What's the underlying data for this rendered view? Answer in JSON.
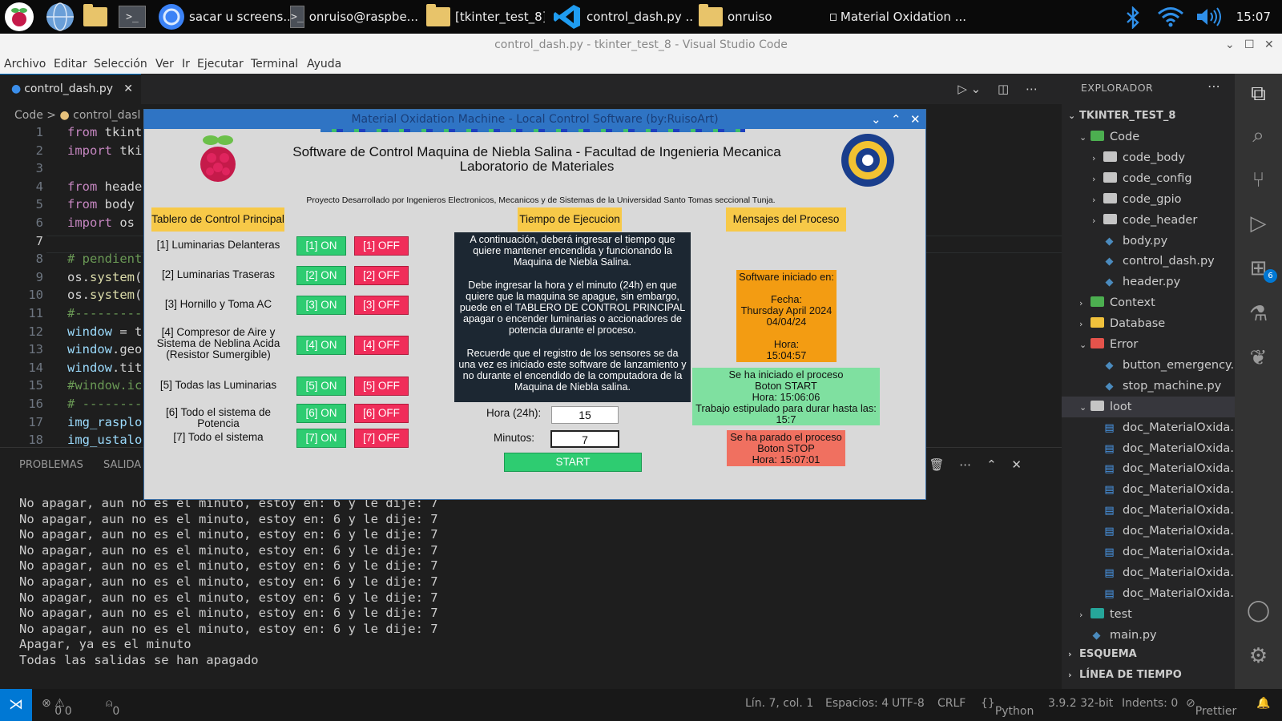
{
  "taskbar": {
    "items": [
      {
        "label": "sacar u screens..."
      },
      {
        "label": "onruiso@raspbe..."
      },
      {
        "label": "[tkinter_test_8]"
      },
      {
        "label": "control_dash.py ..."
      },
      {
        "label": "onruiso"
      },
      {
        "label": "Material Oxidation ..."
      }
    ],
    "terminal_glyph": ">_",
    "clock": "15:07"
  },
  "window": {
    "title": "control_dash.py - tkinter_test_8 - Visual Studio Code"
  },
  "menu": [
    "Archivo",
    "Editar",
    "Selección",
    "Ver",
    "Ir",
    "Ejecutar",
    "Terminal",
    "Ayuda"
  ],
  "editor": {
    "tab": "control_dash.py",
    "breadcrumb_root": "Code",
    "breadcrumb_sep": ">",
    "breadcrumb_file": "control_dasl",
    "lines": [
      {
        "n": "1",
        "parts": [
          {
            "t": "from ",
            "c": "kw"
          },
          {
            "t": "tkint",
            "c": "tx"
          }
        ]
      },
      {
        "n": "2",
        "parts": [
          {
            "t": "import ",
            "c": "kw"
          },
          {
            "t": "tki",
            "c": "tx"
          }
        ]
      },
      {
        "n": "3",
        "parts": []
      },
      {
        "n": "4",
        "parts": [
          {
            "t": "from ",
            "c": "kw"
          },
          {
            "t": "heade",
            "c": "tx"
          }
        ]
      },
      {
        "n": "5",
        "parts": [
          {
            "t": "from ",
            "c": "kw"
          },
          {
            "t": "body ",
            "c": "tx"
          }
        ]
      },
      {
        "n": "6",
        "parts": [
          {
            "t": "import ",
            "c": "kw"
          },
          {
            "t": "os ",
            "c": "tx"
          }
        ]
      },
      {
        "n": "7",
        "parts": []
      },
      {
        "n": "8",
        "parts": [
          {
            "t": "# pendient",
            "c": "cm"
          }
        ]
      },
      {
        "n": "9",
        "parts": [
          {
            "t": "os.",
            "c": "tx"
          },
          {
            "t": "system",
            "c": "fn"
          },
          {
            "t": "(",
            "c": "tx"
          }
        ]
      },
      {
        "n": "10",
        "parts": [
          {
            "t": "os.",
            "c": "tx"
          },
          {
            "t": "system",
            "c": "fn"
          },
          {
            "t": "(",
            "c": "tx"
          }
        ]
      },
      {
        "n": "11",
        "parts": [
          {
            "t": "#----------",
            "c": "cm"
          }
        ]
      },
      {
        "n": "12",
        "parts": [
          {
            "t": "window",
            "c": "vr"
          },
          {
            "t": " = t",
            "c": "tx"
          }
        ]
      },
      {
        "n": "13",
        "parts": [
          {
            "t": "window",
            "c": "vr"
          },
          {
            "t": ".geo",
            "c": "tx"
          }
        ]
      },
      {
        "n": "14",
        "parts": [
          {
            "t": "window",
            "c": "vr"
          },
          {
            "t": ".tit",
            "c": "tx"
          }
        ]
      },
      {
        "n": "15",
        "parts": [
          {
            "t": "#window.ic",
            "c": "cm"
          }
        ]
      },
      {
        "n": "16",
        "parts": [
          {
            "t": "# --------",
            "c": "cm"
          }
        ]
      },
      {
        "n": "17",
        "parts": [
          {
            "t": "img_rasplo",
            "c": "vr"
          }
        ]
      },
      {
        "n": "18",
        "parts": [
          {
            "t": "img_ustalo",
            "c": "vr"
          }
        ]
      }
    ]
  },
  "panel": {
    "tabs": [
      "PROBLEMAS",
      "SALIDA"
    ],
    "output": [
      "No apagar, aun no es el minuto, estoy en: 6 y le dije: 7",
      "No apagar, aun no es el minuto, estoy en: 6 y le dije: 7",
      "No apagar, aun no es el minuto, estoy en: 6 y le dije: 7",
      "No apagar, aun no es el minuto, estoy en: 6 y le dije: 7",
      "No apagar, aun no es el minuto, estoy en: 6 y le dije: 7",
      "No apagar, aun no es el minuto, estoy en: 6 y le dije: 7",
      "No apagar, aun no es el minuto, estoy en: 6 y le dije: 7",
      "No apagar, aun no es el minuto, estoy en: 6 y le dije: 7",
      "No apagar, aun no es el minuto, estoy en: 6 y le dije: 7",
      "Apagar, ya es el minuto",
      "Todas las salidas se han apagado"
    ]
  },
  "explorer": {
    "header": "EXPLORADOR",
    "project": "TKINTER_TEST_8",
    "tree": [
      {
        "label": "Code",
        "kind": "folder",
        "open": true,
        "depth": 1,
        "color": "#4caf50"
      },
      {
        "label": "code_body",
        "kind": "folder",
        "open": false,
        "depth": 2,
        "color": "#c5c5c5"
      },
      {
        "label": "code_config",
        "kind": "folder",
        "open": false,
        "depth": 2,
        "color": "#c5c5c5"
      },
      {
        "label": "code_gpio",
        "kind": "folder",
        "open": false,
        "depth": 2,
        "color": "#c5c5c5"
      },
      {
        "label": "code_header",
        "kind": "folder",
        "open": false,
        "depth": 2,
        "color": "#c5c5c5"
      },
      {
        "label": "body.py",
        "kind": "py",
        "depth": 2
      },
      {
        "label": "control_dash.py",
        "kind": "py",
        "depth": 2
      },
      {
        "label": "header.py",
        "kind": "py",
        "depth": 2
      },
      {
        "label": "Context",
        "kind": "folder",
        "open": false,
        "depth": 1,
        "color": "#4caf50"
      },
      {
        "label": "Database",
        "kind": "folder",
        "open": false,
        "depth": 1,
        "color": "#f0c13c"
      },
      {
        "label": "Error",
        "kind": "folder",
        "open": true,
        "depth": 1,
        "color": "#e5534b"
      },
      {
        "label": "button_emergency...",
        "kind": "py",
        "depth": 2
      },
      {
        "label": "stop_machine.py",
        "kind": "py",
        "depth": 2
      },
      {
        "label": "loot",
        "kind": "folder",
        "open": true,
        "depth": 1,
        "color": "#c5c5c5",
        "selected": true
      },
      {
        "label": "doc_MaterialOxida...",
        "kind": "doc",
        "depth": 2
      },
      {
        "label": "doc_MaterialOxida...",
        "kind": "doc",
        "depth": 2
      },
      {
        "label": "doc_MaterialOxida...",
        "kind": "doc",
        "depth": 2
      },
      {
        "label": "doc_MaterialOxida...",
        "kind": "doc",
        "depth": 2
      },
      {
        "label": "doc_MaterialOxida...",
        "kind": "doc",
        "depth": 2
      },
      {
        "label": "doc_MaterialOxida...",
        "kind": "doc",
        "depth": 2
      },
      {
        "label": "doc_MaterialOxida...",
        "kind": "doc",
        "depth": 2
      },
      {
        "label": "doc_MaterialOxida...",
        "kind": "doc",
        "depth": 2
      },
      {
        "label": "doc_MaterialOxida...",
        "kind": "doc",
        "depth": 2
      },
      {
        "label": "test",
        "kind": "folder",
        "open": false,
        "depth": 1,
        "color": "#26a69a"
      },
      {
        "label": "main.py",
        "kind": "py",
        "depth": 1
      }
    ],
    "outline": "ESQUEMA",
    "timeline": "LÍNEA DE TIEMPO"
  },
  "activity": {
    "extensions_badge": "6"
  },
  "statusbar": {
    "errors": "0",
    "warnings": "0",
    "ports": "0",
    "position": "Lín. 7, col. 1",
    "spaces": "Espacios: 4",
    "encoding": "UTF-8",
    "eol": "CRLF",
    "language": "Python",
    "interpreter": "3.9.2 32-bit",
    "indents": "Indents: 0",
    "formatter": "Prettier"
  },
  "app": {
    "title": "Material Oxidation Machine - Local Control Software (by:RuisoArt)",
    "header_line1": "Software de Control Maquina de Niebla Salina - Facultad de Ingenieria Mecanica",
    "header_line2": "Laboratorio de Materiales",
    "subtitle": "Proyecto Desarrollado por Ingenieros Electronicos, Mecanicos y de Sistemas de la Universidad Santo Tomas seccional Tunja.",
    "panel_labels": {
      "control": "Tablero de Control Principal",
      "time": "Tiempo de Ejecucion",
      "messages": "Mensajes del Proceso"
    },
    "controls": [
      {
        "label": "[1] Luminarias Delanteras",
        "on": "[1] ON",
        "off": "[1] OFF"
      },
      {
        "label": "[2] Luminarias Traseras",
        "on": "[2] ON",
        "off": "[2] OFF"
      },
      {
        "label": "[3] Hornillo y Toma AC",
        "on": "[3] ON",
        "off": "[3] OFF"
      },
      {
        "label": "[4] Compresor de Aire y Sistema de Neblina Acida (Resistor Sumergible)",
        "on": "[4] ON",
        "off": "[4] OFF"
      },
      {
        "label": "[5] Todas las Luminarias",
        "on": "[5] ON",
        "off": "[5] OFF"
      },
      {
        "label": "[6] Todo el sistema de Potencia",
        "on": "[6] ON",
        "off": "[6] OFF"
      },
      {
        "label": "[7] Todo el sistema",
        "on": "[7] ON",
        "off": "[7] OFF"
      }
    ],
    "instructions": [
      "A continuación, deberá ingresar el tiempo que quiere mantener encendida y funcionando la Maquina de Niebla Salina.",
      "Debe ingresar la hora y el minuto (24h) en que quiere que la maquina se apague, sin embargo, puede en el TABLERO DE CONTROL PRINCIPAL apagar o encender luminarias o accionadores de potencia durante el proceso.",
      "Recuerde que el registro de los sensores se da una vez es iniciado este software de lanzamiento y no durante el encendido de la computadora de la Maquina de Niebla salina."
    ],
    "hour_label": "Hora (24h):",
    "hour_value": "15",
    "minutes_label": "Minutos:",
    "minutes_value": "7",
    "start_label": "START",
    "messages": {
      "started_software": [
        "Software iniciado en:",
        "",
        "Fecha:",
        "Thursday April 2024",
        "04/04/24",
        "",
        "Hora:",
        "15:04:57"
      ],
      "process_started": [
        "Se ha iniciado el proceso",
        "Boton START",
        "Hora: 15:06:06",
        "Trabajo estipulado para durar hasta las:",
        "15:7"
      ],
      "process_stopped": [
        "Se ha parado el proceso",
        "Boton STOP",
        "Hora: 15:07:01"
      ]
    },
    "colors": {
      "yellow": "#f7c948",
      "on": "#2ecc71",
      "off": "#f02d5a",
      "orange": "#f39c12",
      "mint": "#7fe0a0",
      "salmon": "#f07060"
    }
  }
}
